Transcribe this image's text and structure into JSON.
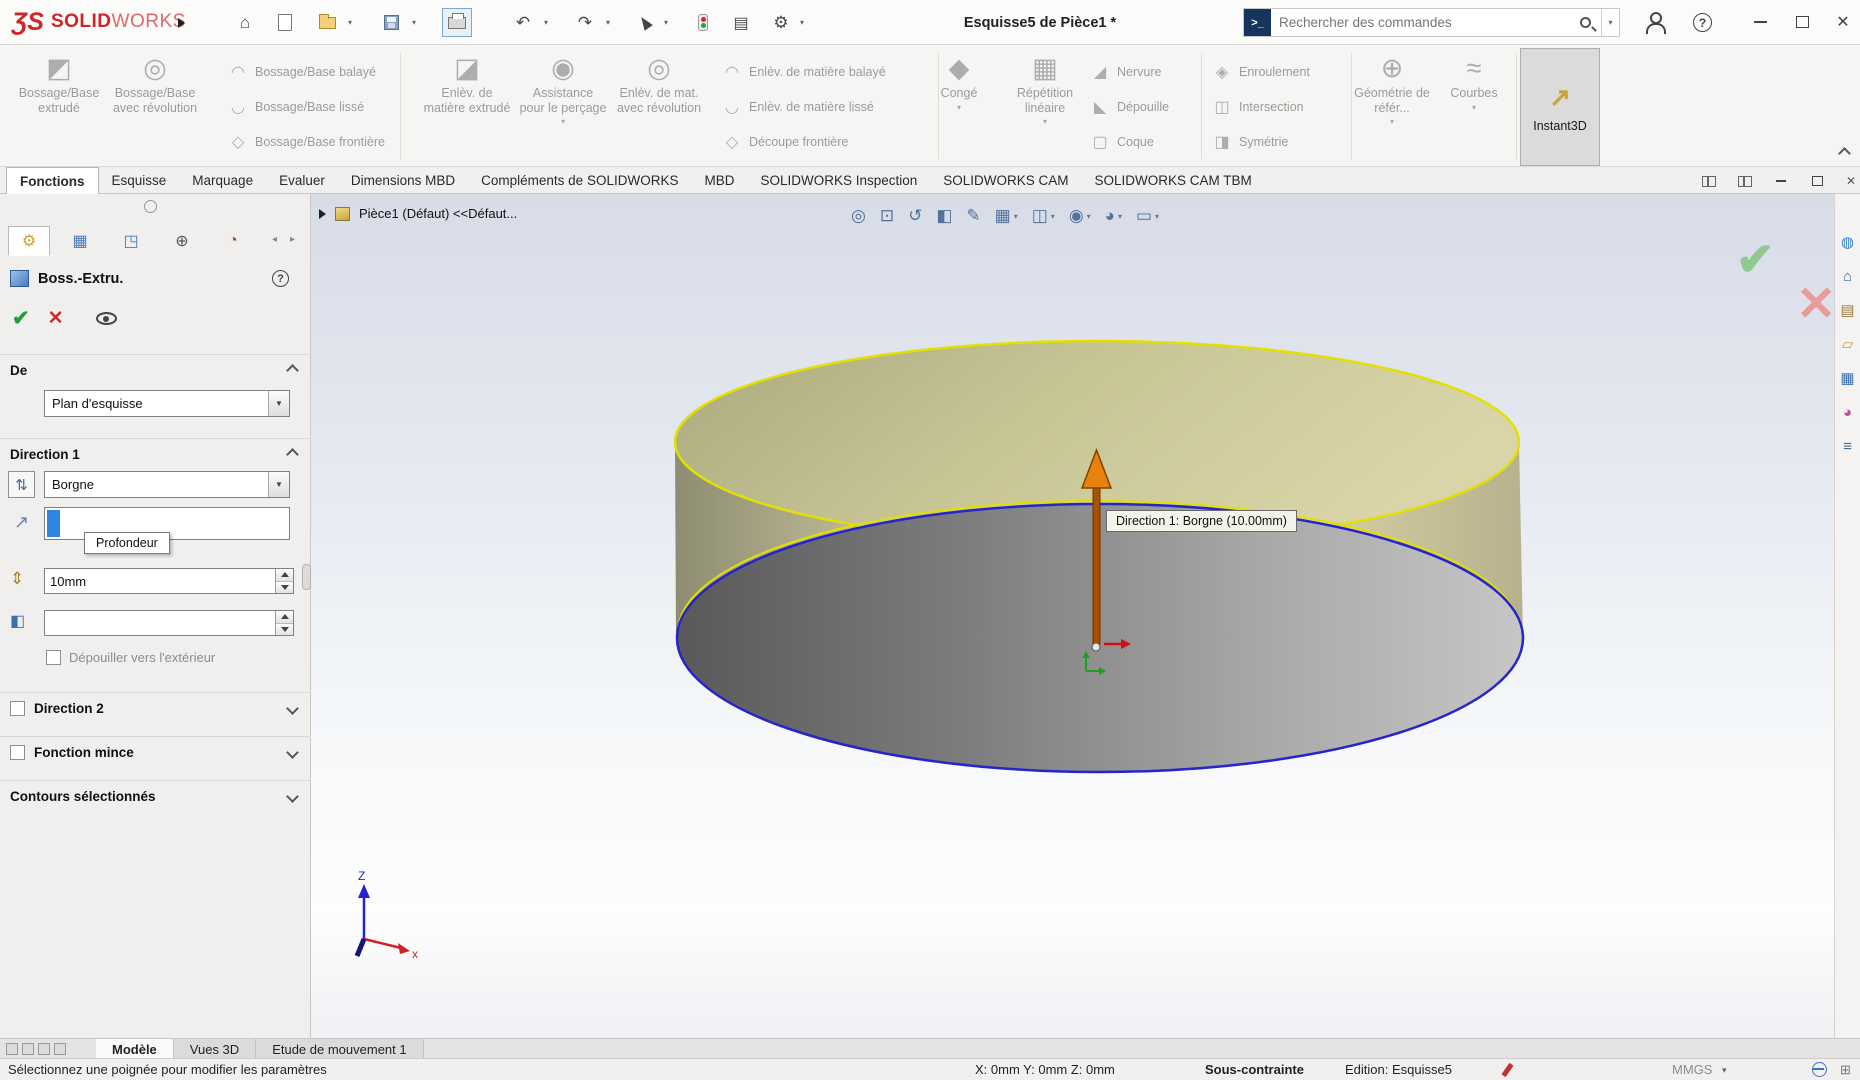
{
  "title_bar": {
    "logo_mark": "ƷS",
    "app_name_solid": "SOLID",
    "app_name_works": "WORKS",
    "document_title": "Esquisse5 de Pièce1 *",
    "search_placeholder": "Rechercher des commandes",
    "search_launch_glyph": ">_",
    "quick_icons": [
      "home",
      "new-document",
      "open",
      "save",
      "print",
      "undo",
      "redo",
      "select",
      "rebuild",
      "options-sheet",
      "settings"
    ]
  },
  "ribbon": {
    "g1_big": [
      {
        "glyph": "◩",
        "label": "Bossage/Base extrudé"
      },
      {
        "glyph": "◎",
        "label": "Bossage/Base avec révolution"
      }
    ],
    "g1_small": [
      {
        "glyph": "◠",
        "label": "Bossage/Base balayé"
      },
      {
        "glyph": "◡",
        "label": "Bossage/Base lissé"
      },
      {
        "glyph": "◇",
        "label": "Bossage/Base frontière"
      }
    ],
    "g2_big": [
      {
        "glyph": "◪",
        "label": "Enlèv. de matière extrudé"
      },
      {
        "glyph": "◉",
        "label": "Assistance pour le perçage",
        "arrow": true
      },
      {
        "glyph": "◎",
        "label": "Enlèv. de mat. avec révolution"
      }
    ],
    "g2_small": [
      {
        "glyph": "◠",
        "label": "Enlèv. de matière balayé"
      },
      {
        "glyph": "◡",
        "label": "Enlèv. de matière lissé"
      },
      {
        "glyph": "◇",
        "label": "Découpe frontière"
      }
    ],
    "g3_big": [
      {
        "glyph": "◆",
        "label": "Congé",
        "arrow": true
      },
      {
        "glyph": "▦",
        "label": "Répétition linéaire",
        "arrow": true
      }
    ],
    "g3_small": [
      {
        "glyph": "◢",
        "label": "Nervure"
      },
      {
        "glyph": "◣",
        "label": "Dépouille"
      },
      {
        "glyph": "▢",
        "label": "Coque"
      }
    ],
    "g4_small": [
      {
        "glyph": "◈",
        "label": "Enroulement"
      },
      {
        "glyph": "◫",
        "label": "Intersection"
      },
      {
        "glyph": "◨",
        "label": "Symétrie"
      }
    ],
    "g5_big": [
      {
        "glyph": "⊕",
        "label": "Géométrie de référ...",
        "arrow": true
      },
      {
        "glyph": "≈",
        "label": "Courbes",
        "arrow": true
      }
    ],
    "instant3d": {
      "glyph": "↗",
      "label": "Instant3D"
    }
  },
  "ribbon_tabs": [
    "Fonctions",
    "Esquisse",
    "Marquage",
    "Evaluer",
    "Dimensions MBD",
    "Compléments de SOLIDWORKS",
    "MBD",
    "SOLIDWORKS Inspection",
    "SOLIDWORKS CAM",
    "SOLIDWORKS CAM TBM"
  ],
  "property_manager": {
    "tabs": [
      {
        "glyph": "⚙",
        "color": "#c9a227"
      },
      {
        "glyph": "▦",
        "color": "#4a7ab5"
      },
      {
        "glyph": "◳",
        "color": "#4a7ab5"
      },
      {
        "glyph": "⊕",
        "color": "#555555"
      },
      {
        "glyph": "◔",
        "color": "#b5452a"
      }
    ],
    "title": "Boss.-Extru.",
    "help_glyph": "?",
    "section_from": "De",
    "from_value": "Plan d'esquisse",
    "section_direction1": "Direction 1",
    "end_condition": "Borgne",
    "depth_tooltip": "Profondeur",
    "depth_value": "10mm",
    "draft_label": "Dépouiller vers l'extérieur",
    "section_direction2": "Direction 2",
    "section_thin": "Fonction mince",
    "section_contours": "Contours sélectionnés"
  },
  "viewport": {
    "breadcrumb": "Pièce1 (Défaut) <<Défaut...",
    "tooltip": "Direction 1: Borgne (10.00mm)",
    "hud_icons": [
      {
        "glyph": "◎"
      },
      {
        "glyph": "⊡"
      },
      {
        "glyph": "↺"
      },
      {
        "glyph": "◧"
      },
      {
        "glyph": "✎"
      },
      {
        "glyph": "▦",
        "arrow": true
      },
      {
        "glyph": "◫",
        "arrow": true
      },
      {
        "glyph": "◉",
        "arrow": true
      },
      {
        "glyph": "◕",
        "arrow": true
      },
      {
        "glyph": "▭",
        "arrow": true
      }
    ],
    "triad": {
      "x_label": "x",
      "z_label": "Z"
    },
    "task_pane_icons": [
      {
        "glyph": "◍",
        "color": "#2f7fd0"
      },
      {
        "glyph": "⌂",
        "color": "#4a6a8a"
      },
      {
        "glyph": "▤",
        "color": "#9a7a3a"
      },
      {
        "glyph": "▱",
        "color": "#c9a43a"
      },
      {
        "glyph": "▦",
        "color": "#3a6fb0"
      },
      {
        "glyph": "◕",
        "color": "#c04a9a"
      },
      {
        "glyph": "≡",
        "color": "#4a6a8a"
      }
    ]
  },
  "bottom_tabs": [
    "Modèle",
    "Vues 3D",
    "Etude de mouvement 1"
  ],
  "status_bar": {
    "message": "Sélectionnez une poignée pour modifier les paramètres",
    "coordinates": "X: 0mm Y: 0mm Z: 0mm",
    "constraint_state": "Sous-contrainte",
    "edition": "Edition: Esquisse5",
    "units": "MMGS"
  },
  "colors": {
    "preview_edge_yellow": "#e3e000",
    "sketch_blue": "#2525cd",
    "selection_blue": "#2f86e0",
    "confirm_green": "#8fc98f",
    "cancel_red": "#e89b9b"
  }
}
